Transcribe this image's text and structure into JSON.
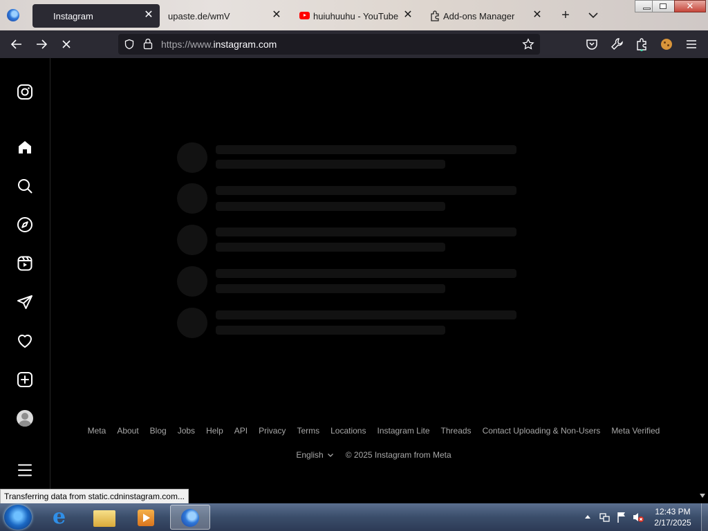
{
  "browser": {
    "tabs": [
      {
        "label": "Instagram",
        "active": true
      },
      {
        "label": "upaste.de/wmV",
        "active": false
      },
      {
        "label": "huiuhuuhu - YouTube",
        "active": false
      },
      {
        "label": "Add-ons Manager",
        "active": false
      }
    ],
    "url_scheme": "https://www.",
    "url_domain": "instagram.com",
    "status_text": "Transferring data from static.cdninstagram.com..."
  },
  "sidebar": {
    "items": [
      {
        "icon": "instagram-icon"
      },
      {
        "icon": "home-icon"
      },
      {
        "icon": "search-icon"
      },
      {
        "icon": "explore-icon"
      },
      {
        "icon": "reels-icon"
      },
      {
        "icon": "messages-icon"
      },
      {
        "icon": "notifications-icon"
      },
      {
        "icon": "create-icon"
      },
      {
        "icon": "profile-icon"
      },
      {
        "icon": "menu-icon"
      }
    ]
  },
  "footer": {
    "links": [
      "Meta",
      "About",
      "Blog",
      "Jobs",
      "Help",
      "API",
      "Privacy",
      "Terms",
      "Locations",
      "Instagram Lite",
      "Threads",
      "Contact Uploading & Non-Users",
      "Meta Verified"
    ],
    "language": "English",
    "copyright": "© 2025 Instagram from Meta"
  },
  "taskbar": {
    "time": "12:43 PM",
    "date": "2/17/2025"
  },
  "colors": {
    "page_bg": "#000000",
    "skeleton": "#121212",
    "toolbar": "#2b2a33",
    "footer_text": "#a8a8a8"
  }
}
